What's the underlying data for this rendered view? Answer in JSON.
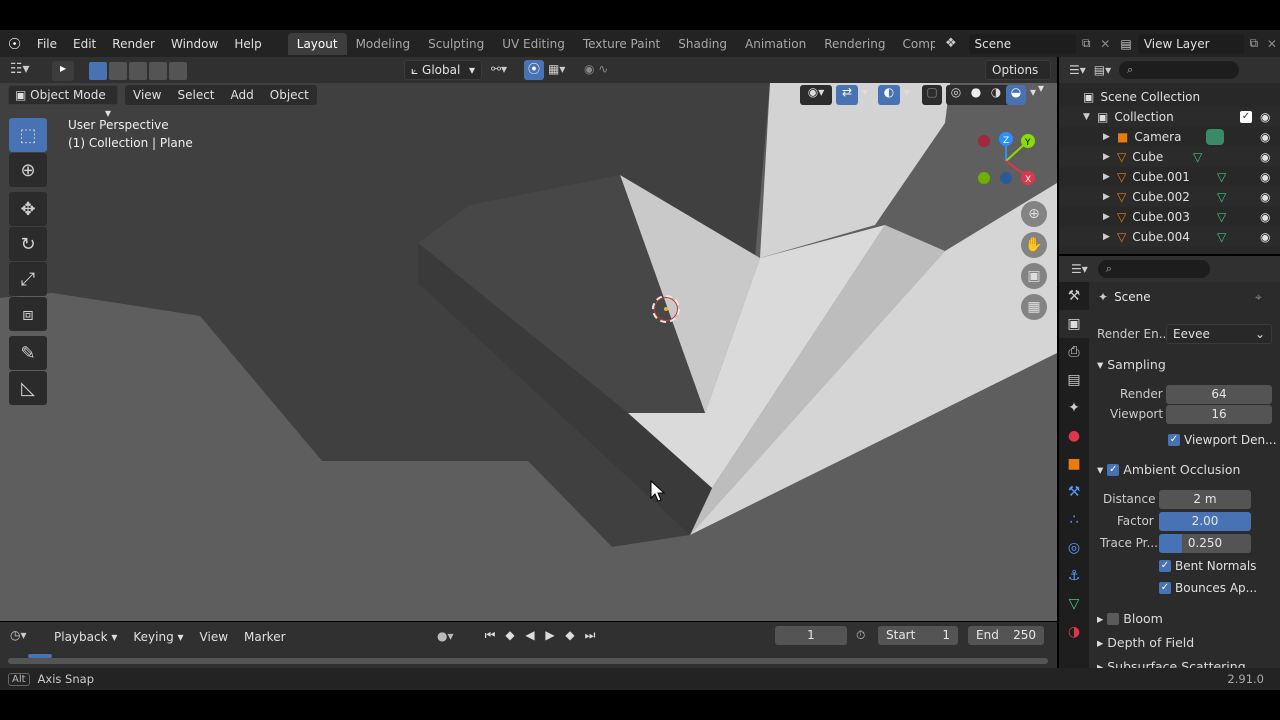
{
  "topbar": {
    "menus": [
      "File",
      "Edit",
      "Render",
      "Window",
      "Help"
    ],
    "workspaces": [
      "Layout",
      "Modeling",
      "Sculpting",
      "UV Editing",
      "Texture Paint",
      "Shading",
      "Animation",
      "Rendering",
      "Compo"
    ],
    "active_workspace": "Layout",
    "scene_name": "Scene",
    "view_layer": "View Layer"
  },
  "viewport_header": {
    "transform_orientation": "Global",
    "options_label": "Options",
    "mode": "Object Mode",
    "menus": [
      "View",
      "Select",
      "Add",
      "Object"
    ]
  },
  "viewport": {
    "perspective_label": "User Perspective",
    "collection_label": "(1) Collection | Plane",
    "gizmo_axes": [
      "Z",
      "Y",
      "X"
    ]
  },
  "timeline": {
    "menus": [
      "Playback",
      "Keying",
      "View",
      "Marker"
    ],
    "current_frame": "1",
    "start_label": "Start",
    "start_value": "1",
    "end_label": "End",
    "end_value": "250"
  },
  "statusbar": {
    "key": "Alt",
    "hint": "Axis Snap",
    "version": "2.91.0"
  },
  "outliner": {
    "root": "Scene Collection",
    "collection": "Collection",
    "items": [
      "Camera",
      "Cube",
      "Cube.001",
      "Cube.002",
      "Cube.003",
      "Cube.004"
    ]
  },
  "properties": {
    "context": "Scene",
    "render_engine_label": "Render En...",
    "render_engine_value": "Eevee",
    "sampling": {
      "title": "Sampling",
      "render_label": "Render",
      "render_value": "64",
      "viewport_label": "Viewport",
      "viewport_value": "16",
      "denoise_label": "Viewport Den..."
    },
    "ao": {
      "title": "Ambient Occlusion",
      "distance_label": "Distance",
      "distance_value": "2 m",
      "factor_label": "Factor",
      "factor_value": "2.00",
      "trace_label": "Trace Pr...",
      "trace_value": "0.250",
      "bent_label": "Bent Normals",
      "bounces_label": "Bounces Ap..."
    },
    "bloom_title": "Bloom",
    "dof_title": "Depth of Field",
    "sss_title": "Subsurface Scattering"
  },
  "colors": {
    "accent": "#4772b3",
    "axis_x": "#e0364a",
    "axis_y": "#8bdc00",
    "axis_z": "#2c8fff",
    "object_orange": "#e87d0d",
    "mesh_green": "#3ec97f"
  }
}
